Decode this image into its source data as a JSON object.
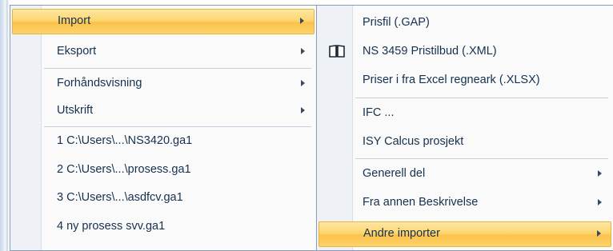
{
  "main_menu": {
    "items": [
      {
        "label": "Import",
        "highlighted": true,
        "has_submenu": true
      },
      {
        "label": "Eksport",
        "has_submenu": true
      },
      {
        "label": "Forhåndsvisning",
        "has_submenu": true
      },
      {
        "label": "Utskrift",
        "has_submenu": true
      },
      {
        "label": "1 C:\\Users\\...\\NS3420.ga1"
      },
      {
        "label": "2 C:\\Users\\...\\prosess.ga1"
      },
      {
        "label": "3 C:\\Users\\...\\asdfcv.ga1"
      },
      {
        "label": "4 ny prosess svv.ga1"
      }
    ]
  },
  "import_submenu": {
    "items": [
      {
        "label": "Prisfil (.GAP)"
      },
      {
        "label": "NS 3459 Pristilbud (.XML)",
        "icon": "book-icon"
      },
      {
        "label": "Priser i fra Excel regneark (.XLSX)"
      },
      {
        "label": "IFC ..."
      },
      {
        "label": "ISY Calcus prosjekt"
      },
      {
        "label": "Generell del",
        "has_submenu": true
      },
      {
        "label": "Fra annen Beskrivelse",
        "has_submenu": true
      },
      {
        "label": "Andre importer",
        "highlighted": true,
        "has_submenu": true
      }
    ]
  },
  "colors": {
    "highlight_top": "#fde7a3",
    "highlight_bottom": "#fbc24c",
    "menu_border": "#8a9db6",
    "text": "#15314f"
  }
}
